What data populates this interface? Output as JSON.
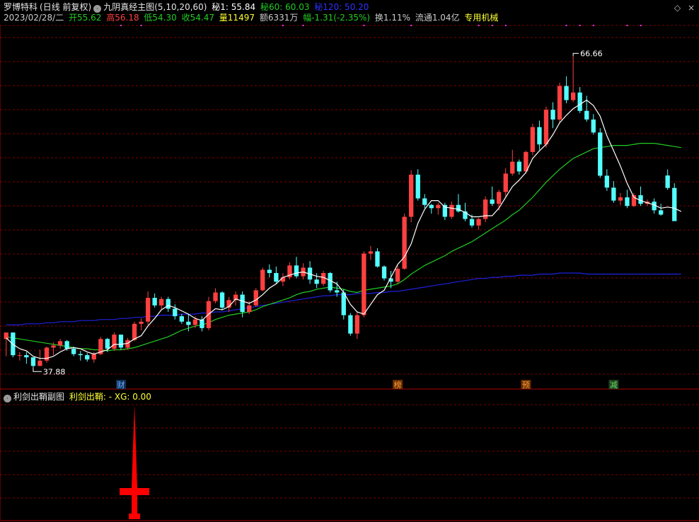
{
  "header": {
    "stock_name": "罗博特科",
    "period": "(日线 前复权)",
    "indicator": "九阴真经主图",
    "params": "(5,10,20,60)",
    "secret1": "秘1: 55.84",
    "secret60": "秘60: 60.03",
    "secret120": "秘120: 50.20"
  },
  "quote": {
    "date": "2023/02/28/二",
    "open": "开55.62",
    "high": "高56.18",
    "low": "低54.30",
    "close": "收54.47",
    "volume": "量11497",
    "amount": "额6331万",
    "change": "幅-1.31(-2.35%)",
    "turnover": "换1.11%",
    "float_cap": "流通1.04亿",
    "sector": "专用机械"
  },
  "sub": {
    "title": "利剑出鞘副图",
    "line": "利剑出鞘: -  XG: 0.00"
  },
  "markers": [
    "财",
    "榜",
    "预",
    "减"
  ],
  "window_controls": [
    "◇",
    "×"
  ],
  "colors": {
    "up": "#ff4040",
    "down": "#54ffff",
    "ma_white": "#ffffff",
    "ma_green": "#22cc22",
    "ma_blue": "#2020dd",
    "grid": "#7a0000",
    "signal": "#ff0000"
  },
  "chart_data": {
    "type": "candlestick",
    "y_range": [
      36.0,
      69.5
    ],
    "annotations": [
      {
        "text": "66.66",
        "type": "high",
        "at_bar": 84
      },
      {
        "text": "37.88",
        "type": "low",
        "at_bar": 4
      }
    ],
    "ohlc": [
      [
        40.5,
        41.1,
        38.9,
        41.1
      ],
      [
        41.1,
        41.1,
        38.8,
        39.0
      ],
      [
        39.0,
        39.3,
        38.5,
        39.0
      ],
      [
        39.0,
        39.3,
        38.2,
        38.8
      ],
      [
        38.8,
        38.8,
        37.88,
        38.0
      ],
      [
        38.0,
        39.5,
        38.0,
        38.5
      ],
      [
        38.5,
        39.8,
        38.3,
        39.7
      ],
      [
        39.7,
        40.2,
        39.0,
        39.9
      ],
      [
        39.9,
        40.5,
        39.6,
        40.3
      ],
      [
        40.3,
        40.4,
        39.4,
        39.6
      ],
      [
        39.6,
        39.8,
        38.9,
        39.1
      ],
      [
        39.1,
        39.4,
        38.5,
        39.0
      ],
      [
        39.0,
        39.2,
        38.4,
        38.6
      ],
      [
        38.6,
        39.3,
        38.3,
        39.1
      ],
      [
        39.1,
        40.7,
        39.0,
        40.5
      ],
      [
        40.5,
        40.6,
        39.3,
        39.6
      ],
      [
        39.6,
        41.1,
        39.4,
        40.9
      ],
      [
        40.9,
        40.9,
        39.5,
        39.7
      ],
      [
        39.7,
        40.6,
        39.5,
        40.4
      ],
      [
        40.4,
        42.1,
        40.3,
        41.9
      ],
      [
        41.9,
        42.4,
        41.3,
        42.1
      ],
      [
        42.1,
        44.9,
        41.8,
        44.3
      ],
      [
        44.3,
        44.7,
        43.4,
        43.6
      ],
      [
        43.6,
        44.4,
        43.2,
        44.2
      ],
      [
        44.2,
        44.4,
        43.0,
        43.3
      ],
      [
        43.3,
        43.7,
        42.3,
        42.6
      ],
      [
        42.6,
        42.8,
        41.9,
        42.1
      ],
      [
        42.1,
        42.8,
        41.2,
        41.8
      ],
      [
        41.8,
        42.6,
        41.5,
        42.3
      ],
      [
        42.3,
        42.6,
        41.2,
        41.5
      ],
      [
        41.5,
        44.4,
        41.3,
        44.0
      ],
      [
        44.0,
        45.2,
        43.8,
        44.8
      ],
      [
        44.8,
        44.9,
        43.2,
        43.4
      ],
      [
        43.4,
        44.4,
        43.0,
        44.1
      ],
      [
        44.1,
        44.9,
        43.6,
        44.6
      ],
      [
        44.6,
        44.9,
        42.5,
        43.0
      ],
      [
        43.0,
        44.0,
        42.8,
        43.6
      ],
      [
        43.6,
        45.2,
        43.5,
        45.0
      ],
      [
        45.0,
        47.1,
        44.9,
        46.9
      ],
      [
        46.9,
        47.4,
        46.2,
        46.6
      ],
      [
        46.6,
        47.2,
        45.6,
        45.8
      ],
      [
        45.8,
        46.6,
        45.4,
        46.2
      ],
      [
        46.2,
        47.6,
        46.0,
        47.3
      ],
      [
        47.3,
        48.1,
        46.1,
        46.3
      ],
      [
        46.3,
        47.5,
        46.0,
        47.1
      ],
      [
        47.1,
        47.7,
        45.6,
        46.0
      ],
      [
        46.0,
        46.6,
        45.2,
        45.6
      ],
      [
        45.6,
        46.8,
        45.4,
        46.6
      ],
      [
        46.6,
        46.7,
        44.8,
        45.0
      ],
      [
        45.0,
        45.8,
        44.4,
        44.8
      ],
      [
        44.8,
        45.1,
        42.3,
        42.7
      ],
      [
        42.7,
        42.9,
        40.8,
        41.0
      ],
      [
        41.0,
        43.0,
        40.5,
        42.7
      ],
      [
        42.7,
        48.6,
        42.5,
        48.4
      ],
      [
        48.4,
        49.1,
        47.8,
        48.6
      ],
      [
        48.6,
        48.9,
        47.1,
        47.2
      ],
      [
        47.2,
        47.3,
        45.9,
        46.1
      ],
      [
        46.1,
        46.8,
        45.2,
        45.8
      ],
      [
        45.8,
        47.3,
        45.6,
        47.0
      ],
      [
        47.0,
        52.1,
        46.9,
        51.8
      ],
      [
        51.8,
        56.1,
        51.3,
        55.7
      ],
      [
        55.7,
        56.2,
        53.3,
        53.5
      ],
      [
        53.5,
        53.9,
        52.6,
        52.9
      ],
      [
        52.9,
        53.0,
        52.1,
        52.6
      ],
      [
        52.6,
        53.1,
        52.0,
        52.9
      ],
      [
        52.9,
        53.1,
        51.5,
        51.8
      ],
      [
        51.8,
        53.2,
        51.6,
        52.9
      ],
      [
        52.9,
        53.9,
        52.2,
        52.3
      ],
      [
        52.3,
        53.1,
        51.4,
        51.6
      ],
      [
        51.6,
        52.0,
        50.8,
        51.0
      ],
      [
        51.0,
        51.7,
        50.6,
        51.6
      ],
      [
        51.6,
        53.7,
        51.3,
        53.4
      ],
      [
        53.4,
        54.6,
        52.8,
        53.0
      ],
      [
        53.0,
        54.3,
        52.4,
        54.1
      ],
      [
        54.1,
        56.3,
        53.7,
        55.8
      ],
      [
        55.8,
        58.0,
        55.6,
        56.9
      ],
      [
        56.9,
        57.1,
        55.7,
        56.0
      ],
      [
        56.0,
        57.9,
        55.8,
        57.8
      ],
      [
        57.8,
        60.4,
        57.5,
        60.1
      ],
      [
        60.1,
        60.7,
        58.0,
        58.5
      ],
      [
        58.5,
        62.0,
        58.2,
        61.7
      ],
      [
        61.7,
        62.4,
        60.0,
        60.8
      ],
      [
        60.8,
        64.2,
        60.5,
        63.9
      ],
      [
        63.9,
        64.8,
        62.3,
        62.6
      ],
      [
        62.6,
        66.66,
        62.4,
        63.3
      ],
      [
        63.3,
        63.8,
        61.4,
        61.6
      ],
      [
        61.6,
        63.0,
        60.6,
        60.8
      ],
      [
        60.8,
        61.3,
        59.4,
        59.6
      ],
      [
        59.6,
        60.0,
        55.4,
        55.6
      ],
      [
        55.6,
        56.2,
        54.2,
        54.5
      ],
      [
        54.5,
        55.1,
        53.1,
        53.3
      ],
      [
        53.3,
        54.0,
        52.9,
        53.6
      ],
      [
        53.6,
        54.3,
        52.6,
        52.8
      ],
      [
        52.8,
        54.0,
        52.7,
        53.8
      ],
      [
        53.8,
        54.6,
        52.8,
        53.0
      ],
      [
        53.0,
        53.4,
        52.8,
        53.2
      ],
      [
        53.2,
        53.5,
        52.1,
        52.4
      ],
      [
        52.4,
        53.0,
        51.9,
        52.0
      ],
      [
        55.62,
        56.18,
        54.3,
        54.47
      ],
      [
        54.47,
        54.9,
        51.5,
        51.4
      ]
    ],
    "ma5": [
      40.6,
      40.0,
      39.6,
      39.4,
      38.9,
      38.7,
      38.7,
      38.9,
      39.3,
      39.6,
      39.7,
      39.6,
      39.3,
      39.1,
      39.3,
      39.5,
      40.0,
      40.0,
      40.1,
      40.5,
      40.8,
      41.7,
      42.4,
      43.2,
      43.6,
      43.4,
      43.1,
      42.8,
      42.4,
      42.2,
      42.8,
      43.3,
      43.2,
      43.5,
      44.2,
      44.0,
      43.8,
      44.1,
      44.6,
      45.2,
      45.6,
      46.2,
      46.4,
      46.6,
      46.7,
      46.5,
      46.3,
      46.2,
      45.9,
      45.6,
      44.8,
      43.7,
      43.0,
      42.8,
      43.7,
      44.6,
      45.0,
      46.2,
      47.4,
      48.1,
      49.3,
      51.2,
      52.5,
      53.3,
      53.3,
      52.7,
      52.6,
      52.5,
      52.2,
      51.8,
      51.8,
      51.9,
      51.9,
      52.6,
      53.6,
      54.6,
      55.2,
      55.9,
      57.2,
      57.9,
      58.5,
      59.4,
      60.5,
      61.2,
      61.8,
      62.2,
      62.6,
      62.1,
      61.1,
      59.3,
      57.9,
      56.5,
      54.9,
      53.6,
      53.3,
      53.1,
      52.9,
      52.6,
      52.7,
      52.6,
      52.3
    ],
    "ma20": [
      40.7,
      40.6,
      40.5,
      40.4,
      40.3,
      40.2,
      40.1,
      40.0,
      39.9,
      39.8,
      39.7,
      39.6,
      39.6,
      39.5,
      39.5,
      39.4,
      39.5,
      39.5,
      39.6,
      39.7,
      39.9,
      40.1,
      40.3,
      40.5,
      40.7,
      41.0,
      41.3,
      41.5,
      41.7,
      41.8,
      42.0,
      42.3,
      42.5,
      42.7,
      42.8,
      42.9,
      43.0,
      43.2,
      43.5,
      43.7,
      43.9,
      44.1,
      44.3,
      44.6,
      44.8,
      44.9,
      45.1,
      45.2,
      45.3,
      45.2,
      45.1,
      44.9,
      44.8,
      45.0,
      45.1,
      45.2,
      45.3,
      45.4,
      45.6,
      46.0,
      46.5,
      46.9,
      47.3,
      47.6,
      47.9,
      48.2,
      48.6,
      48.9,
      49.2,
      49.5,
      49.9,
      50.3,
      50.7,
      51.1,
      51.5,
      52.0,
      52.4,
      53.0,
      53.6,
      54.3,
      55.0,
      55.6,
      56.2,
      56.7,
      57.2,
      57.5,
      57.8,
      58.1,
      58.2,
      58.3,
      58.4,
      58.4,
      58.4,
      58.5,
      58.6,
      58.6,
      58.6,
      58.5,
      58.4,
      58.3,
      58.2
    ],
    "ma60": [
      41.8,
      41.8,
      41.8,
      41.9,
      41.9,
      41.9,
      42.0,
      42.0,
      42.1,
      42.1,
      42.1,
      42.2,
      42.2,
      42.2,
      42.3,
      42.3,
      42.3,
      42.4,
      42.4,
      42.5,
      42.5,
      42.6,
      42.6,
      42.7,
      42.7,
      42.7,
      42.8,
      42.8,
      42.8,
      42.9,
      42.9,
      43.0,
      43.0,
      43.1,
      43.2,
      43.3,
      43.4,
      43.5,
      43.6,
      43.7,
      43.8,
      43.9,
      44.0,
      44.1,
      44.2,
      44.3,
      44.4,
      44.5,
      44.5,
      44.6,
      44.6,
      44.6,
      44.7,
      44.7,
      44.7,
      44.8,
      44.8,
      44.9,
      44.9,
      45.0,
      45.1,
      45.2,
      45.3,
      45.4,
      45.5,
      45.6,
      45.7,
      45.8,
      45.9,
      46.0,
      46.1,
      46.1,
      46.2,
      46.2,
      46.3,
      46.3,
      46.4,
      46.4,
      46.4,
      46.5,
      46.5,
      46.5,
      46.6,
      46.6,
      46.6,
      46.6,
      46.5,
      46.5,
      46.5,
      46.5,
      46.5,
      46.5,
      46.5,
      46.5,
      46.5,
      46.5,
      46.5,
      46.5,
      46.5,
      46.5,
      46.5
    ],
    "top_dots_at_bars": [
      17,
      20,
      41,
      44,
      53,
      60,
      70,
      72,
      74,
      83,
      85,
      87,
      92,
      94
    ],
    "marker_bars": [
      17,
      58,
      77,
      90
    ],
    "signal": {
      "at_bar": 19,
      "value": 1
    }
  }
}
